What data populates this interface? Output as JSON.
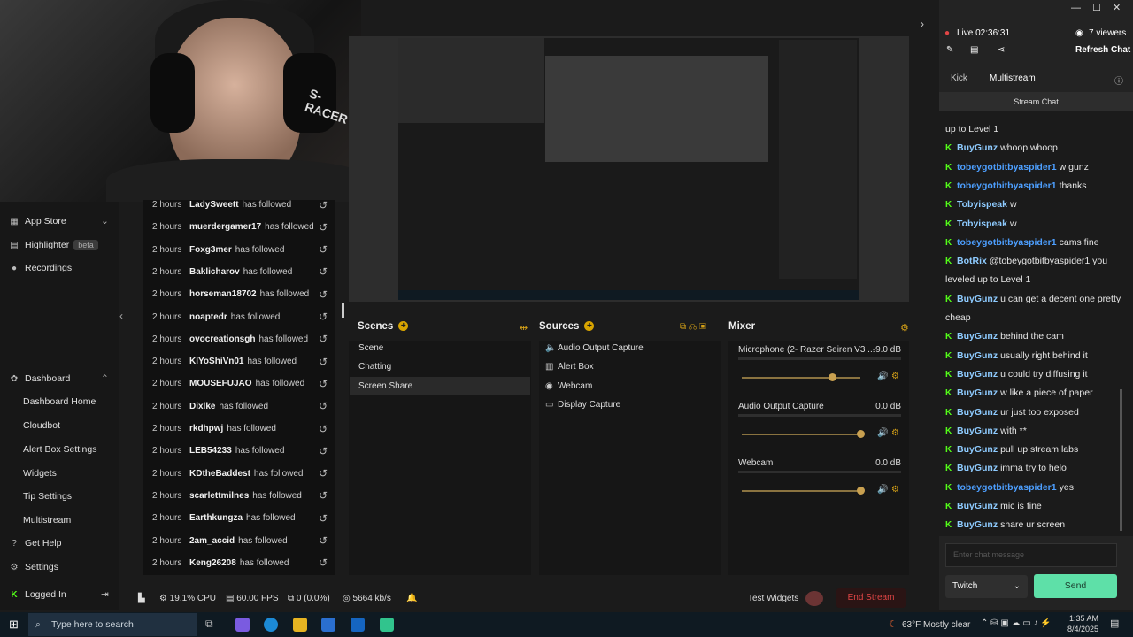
{
  "webcam": {
    "brand_text": "S-RACER"
  },
  "sidebar": {
    "items": [
      {
        "label": "App Store",
        "icon": "grid-icon",
        "chevron": "⌄"
      },
      {
        "label": "Highlighter",
        "icon": "film-icon",
        "badge": "beta"
      },
      {
        "label": "Recordings",
        "icon": "record-icon"
      }
    ],
    "dashboard": {
      "label": "Dashboard",
      "icon": "paint-icon",
      "chevron": "⌃"
    },
    "dashboard_items": [
      "Dashboard Home",
      "Cloudbot",
      "Alert Box Settings",
      "Widgets",
      "Tip Settings",
      "Multistream"
    ],
    "get_help": "Get Help",
    "settings": "Settings",
    "logged_in": "Logged In"
  },
  "events": [
    {
      "time": "2 hours",
      "user": "LadySweett",
      "action": "has followed"
    },
    {
      "time": "2 hours",
      "user": "muerdergamer17",
      "action": "has followed"
    },
    {
      "time": "2 hours",
      "user": "Foxg3mer",
      "action": "has followed"
    },
    {
      "time": "2 hours",
      "user": "Baklicharov",
      "action": "has followed"
    },
    {
      "time": "2 hours",
      "user": "horseman18702",
      "action": "has followed"
    },
    {
      "time": "2 hours",
      "user": "noaptedr",
      "action": "has followed"
    },
    {
      "time": "2 hours",
      "user": "ovocreationsgh",
      "action": "has followed"
    },
    {
      "time": "2 hours",
      "user": "KlYoShiVn01",
      "action": "has followed"
    },
    {
      "time": "2 hours",
      "user": "MOUSEFUJAO",
      "action": "has followed"
    },
    {
      "time": "2 hours",
      "user": "Dixlke",
      "action": "has followed"
    },
    {
      "time": "2 hours",
      "user": "rkdhpwj",
      "action": "has followed"
    },
    {
      "time": "2 hours",
      "user": "LEB54233",
      "action": "has followed"
    },
    {
      "time": "2 hours",
      "user": "KDtheBaddest",
      "action": "has followed"
    },
    {
      "time": "2 hours",
      "user": "scarlettmilnes",
      "action": "has followed"
    },
    {
      "time": "2 hours",
      "user": "Earthkungza",
      "action": "has followed"
    },
    {
      "time": "2 hours",
      "user": "2am_accid",
      "action": "has followed"
    },
    {
      "time": "2 hours",
      "user": "Keng26208",
      "action": "has followed"
    }
  ],
  "scenes": {
    "title": "Scenes",
    "items": [
      "Scene",
      "Chatting",
      "Screen Share"
    ],
    "active_index": 2
  },
  "sources": {
    "title": "Sources",
    "items": [
      {
        "label": "Audio Output Capture",
        "icon": "speaker-icon"
      },
      {
        "label": "Alert Box",
        "icon": "alert-icon"
      },
      {
        "label": "Webcam",
        "icon": "camera-icon"
      },
      {
        "label": "Display Capture",
        "icon": "monitor-icon"
      }
    ]
  },
  "mixer": {
    "title": "Mixer",
    "channels": [
      {
        "name": "Microphone (2- Razer Seiren V3 ...",
        "db": "-9.0 dB",
        "level": 0.76
      },
      {
        "name": "Audio Output Capture",
        "db": "0.0 dB",
        "level": 1.0
      },
      {
        "name": "Webcam",
        "db": "0.0 dB",
        "level": 1.0
      }
    ]
  },
  "status": {
    "cpu": "19.1% CPU",
    "fps": "60.00 FPS",
    "dropped": "0 (0.0%)",
    "bitrate": "5664 kb/s",
    "test_widgets": "Test Widgets",
    "end_stream": "End Stream"
  },
  "chat": {
    "live": "Live 02:36:31",
    "viewers": "7 viewers",
    "refresh": "Refresh Chat",
    "tabs": [
      "Kick",
      "Multistream"
    ],
    "active_tab": "Multistream",
    "stream_chat": "Stream Chat",
    "messages": [
      {
        "user": "",
        "text": "up to Level 1"
      },
      {
        "user": "BuyGunz",
        "text": "whoop whoop",
        "color": "#8ecbff"
      },
      {
        "user": "tobeygotbitbyaspider1",
        "text": "w gunz",
        "color": "#4d9fff"
      },
      {
        "user": "tobeygotbitbyaspider1",
        "text": "thanks",
        "color": "#4d9fff"
      },
      {
        "user": "Tobyispeak",
        "text": "w",
        "color": "#8ecbff"
      },
      {
        "user": "Tobyispeak",
        "text": "w",
        "color": "#8ecbff"
      },
      {
        "user": "tobeygotbitbyaspider1",
        "text": "cams fine",
        "color": "#4d9fff"
      },
      {
        "user": "BotRix",
        "text": "@tobeygotbitbyaspider1 you leveled up to Level 1",
        "color": "#8ecbff"
      },
      {
        "user": "BuyGunz",
        "text": "u can get a decent one pretty cheap",
        "color": "#8ecbff"
      },
      {
        "user": "BuyGunz",
        "text": "behind the cam",
        "color": "#8ecbff"
      },
      {
        "user": "BuyGunz",
        "text": "usually right behind it",
        "color": "#8ecbff"
      },
      {
        "user": "BuyGunz",
        "text": "u could try diffusing it",
        "color": "#8ecbff"
      },
      {
        "user": "BuyGunz",
        "text": "w like a piece of paper",
        "color": "#8ecbff"
      },
      {
        "user": "BuyGunz",
        "text": "ur just too exposed",
        "color": "#8ecbff"
      },
      {
        "user": "BuyGunz",
        "text": "with **",
        "color": "#8ecbff"
      },
      {
        "user": "BuyGunz",
        "text": "pull up stream labs",
        "color": "#8ecbff"
      },
      {
        "user": "BuyGunz",
        "text": "imma try to helo",
        "color": "#8ecbff"
      },
      {
        "user": "tobeygotbitbyaspider1",
        "text": "yes",
        "color": "#4d9fff"
      },
      {
        "user": "BuyGunz",
        "text": "mic is fine",
        "color": "#8ecbff"
      },
      {
        "user": "BuyGunz",
        "text": "share ur screen",
        "color": "#8ecbff"
      }
    ],
    "input_placeholder": "Enter chat message",
    "platform": "Twitch",
    "send": "Send"
  },
  "taskbar": {
    "search_placeholder": "Type here to search",
    "weather": "63°F  Mostly clear",
    "time": "1:35 AM",
    "date": "8/4/2025"
  },
  "colors": {
    "accent": "#53fc18",
    "send": "#5ee0a8",
    "end_stream": "#e04545",
    "scene_plus": "#d8a400"
  }
}
